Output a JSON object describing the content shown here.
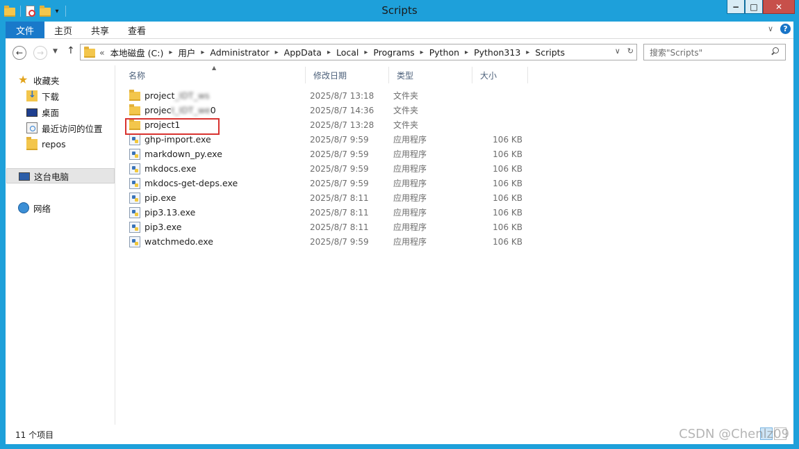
{
  "window": {
    "title": "Scripts"
  },
  "ribbon": {
    "tabs": [
      {
        "label": "文件"
      },
      {
        "label": "主页"
      },
      {
        "label": "共享"
      },
      {
        "label": "查看"
      }
    ]
  },
  "address": {
    "lead": "«",
    "crumbs": [
      "本地磁盘 (C:)",
      "用户",
      "Administrator",
      "AppData",
      "Local",
      "Programs",
      "Python",
      "Python313",
      "Scripts"
    ]
  },
  "search": {
    "placeholder": "搜索\"Scripts\""
  },
  "sidebar": {
    "items": [
      {
        "label": "收藏夹",
        "icon": "star-icon"
      },
      {
        "label": "下载",
        "icon": "download-folder-icon"
      },
      {
        "label": "桌面",
        "icon": "desktop-icon"
      },
      {
        "label": "最近访问的位置",
        "icon": "recent-places-icon"
      },
      {
        "label": "repos",
        "icon": "folder-icon"
      },
      {
        "label": "这台电脑",
        "icon": "computer-icon"
      },
      {
        "label": "网络",
        "icon": "network-icon"
      }
    ]
  },
  "columns": {
    "name": "名称",
    "date": "修改日期",
    "type": "类型",
    "size": "大小"
  },
  "files": [
    {
      "name_prefix": "project",
      "name_obscured": "_IDT_ws",
      "name_suffix": "",
      "date": "2025/8/7 13:18",
      "type": "文件夹",
      "size": "",
      "icon": "folder"
    },
    {
      "name_prefix": "projec",
      "name_obscured": "t_IDT_we",
      "name_suffix": "0",
      "date": "2025/8/7 14:36",
      "type": "文件夹",
      "size": "",
      "icon": "folder"
    },
    {
      "name_prefix": "project1",
      "name_obscured": "",
      "name_suffix": "",
      "date": "2025/8/7 13:28",
      "type": "文件夹",
      "size": "",
      "icon": "folder"
    },
    {
      "name_prefix": "ghp-import.exe",
      "name_obscured": "",
      "name_suffix": "",
      "date": "2025/8/7 9:59",
      "type": "应用程序",
      "size": "106 KB",
      "icon": "exe"
    },
    {
      "name_prefix": "markdown_py.exe",
      "name_obscured": "",
      "name_suffix": "",
      "date": "2025/8/7 9:59",
      "type": "应用程序",
      "size": "106 KB",
      "icon": "exe"
    },
    {
      "name_prefix": "mkdocs.exe",
      "name_obscured": "",
      "name_suffix": "",
      "date": "2025/8/7 9:59",
      "type": "应用程序",
      "size": "106 KB",
      "icon": "exe"
    },
    {
      "name_prefix": "mkdocs-get-deps.exe",
      "name_obscured": "",
      "name_suffix": "",
      "date": "2025/8/7 9:59",
      "type": "应用程序",
      "size": "106 KB",
      "icon": "exe"
    },
    {
      "name_prefix": "pip.exe",
      "name_obscured": "",
      "name_suffix": "",
      "date": "2025/8/7 8:11",
      "type": "应用程序",
      "size": "106 KB",
      "icon": "exe"
    },
    {
      "name_prefix": "pip3.13.exe",
      "name_obscured": "",
      "name_suffix": "",
      "date": "2025/8/7 8:11",
      "type": "应用程序",
      "size": "106 KB",
      "icon": "exe"
    },
    {
      "name_prefix": "pip3.exe",
      "name_obscured": "",
      "name_suffix": "",
      "date": "2025/8/7 8:11",
      "type": "应用程序",
      "size": "106 KB",
      "icon": "exe"
    },
    {
      "name_prefix": "watchmedo.exe",
      "name_obscured": "",
      "name_suffix": "",
      "date": "2025/8/7 9:59",
      "type": "应用程序",
      "size": "106 KB",
      "icon": "exe"
    }
  ],
  "status": {
    "count": "11 个项目"
  },
  "watermark": "CSDN @Chenlz09",
  "colors": {
    "titlebar": "#1ea0da",
    "file_tab": "#1979ca",
    "highlight": "#d8322f"
  }
}
